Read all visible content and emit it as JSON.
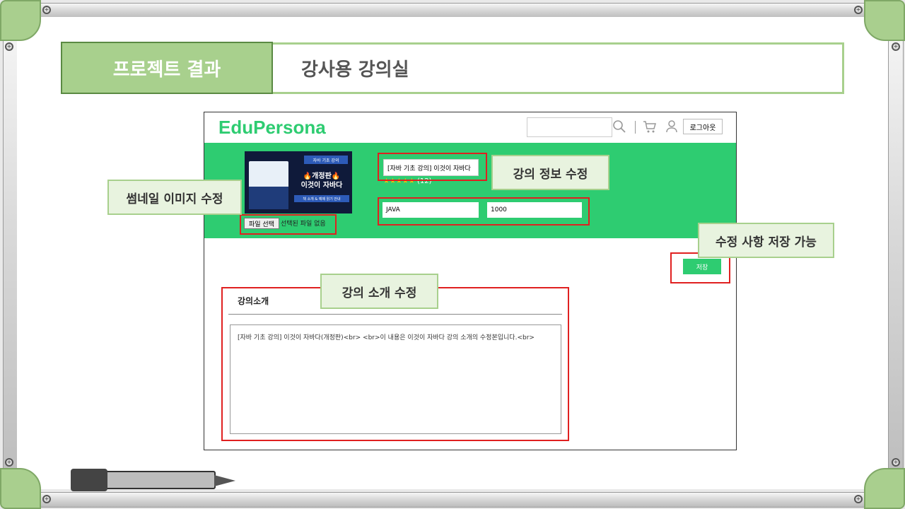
{
  "slide": {
    "section_label": "프로젝트 결과",
    "page_title": "강사용 강의실"
  },
  "app": {
    "logo": "EduPersona",
    "search_placeholder": "",
    "logout_label": "로그아웃"
  },
  "course": {
    "title_value": "[자바 기초 강의] 이것이 자바다",
    "rating_stars": "★★★★★",
    "rating_count": "(12)",
    "category_value": "JAVA",
    "price_value": "1000",
    "file_button_label": "파일 선택",
    "file_status": "선택된 파일 없음",
    "thumbnail": {
      "headline": "🔥개정판🔥\n이것이 자바다",
      "tag": "자바 기초 강의",
      "sub": "책 소개 & 예제 읽기 안내"
    }
  },
  "save_label": "저장",
  "intro": {
    "heading": "강의소개",
    "text": "[자바 기초 강의] 이것이 자바다(개정판)<br> <br>이 내용은 이것이 자바다 강의 소개의 수정본입니다.<br>"
  },
  "callouts": {
    "thumbnail": "썸네일 이미지 수정",
    "course_info": "강의 정보 수정",
    "save": "수정 사항 저장 가능",
    "intro": "강의 소개 수정"
  },
  "colors": {
    "accent_green": "#2ecc71",
    "header_green": "#a8d08d",
    "highlight_red": "#e02020"
  },
  "icons": [
    "search-icon",
    "cart-icon",
    "user-icon"
  ]
}
